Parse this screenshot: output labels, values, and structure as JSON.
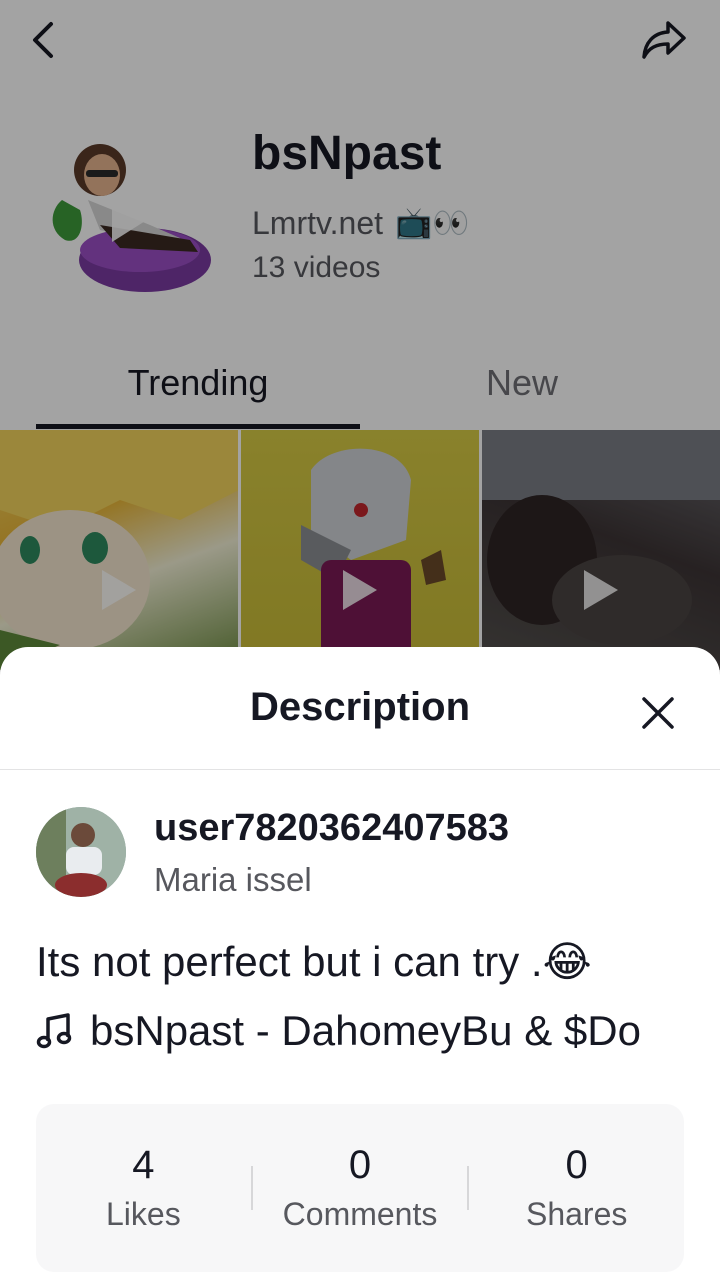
{
  "playlist": {
    "title": "bsNpast",
    "subtitle": "Lmrtv.net",
    "subtitle_emoji": "📺👀",
    "video_count": "13 videos"
  },
  "tabs": [
    {
      "label": "Trending",
      "active": true
    },
    {
      "label": "New",
      "active": false
    }
  ],
  "icons": {
    "back": "chevron-left-icon",
    "share": "share-arrow-icon",
    "play": "play-icon",
    "close": "close-icon",
    "music": "music-note-icon"
  },
  "sheet": {
    "title": "Description",
    "username": "user7820362407583",
    "nickname": "Maria issel",
    "description": "Its not perfect but i can try .😂",
    "music": "bsNpast - DahomeyBu & $Do",
    "stats": [
      {
        "value": "4",
        "label": "Likes"
      },
      {
        "value": "0",
        "label": "Comments"
      },
      {
        "value": "0",
        "label": "Shares"
      }
    ]
  },
  "colors": {
    "text_primary": "#161823",
    "text_secondary": "#57585e",
    "overlay": "rgba(0,0,0,0.36)"
  }
}
